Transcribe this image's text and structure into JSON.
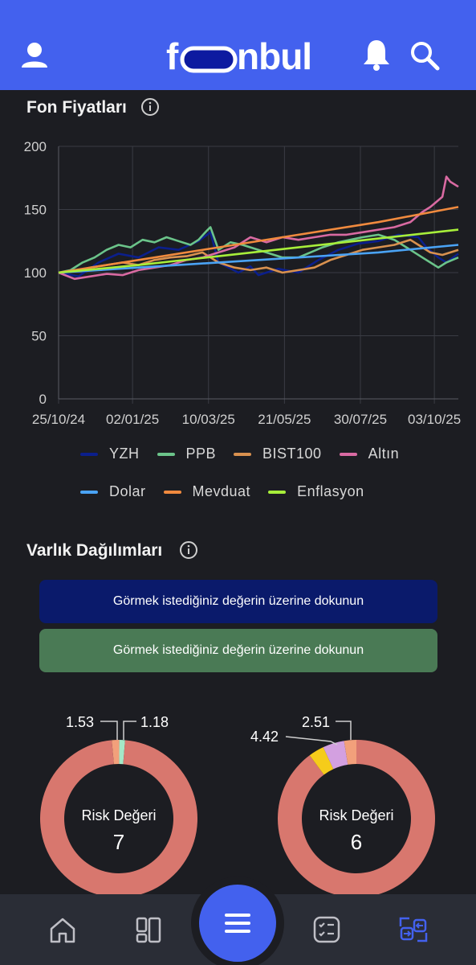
{
  "app": {
    "logo_text": "fonbul.",
    "colors": {
      "brand": "#4361ee",
      "background": "#1c1d22",
      "nav": "#2a2d36"
    },
    "icons": {
      "profile": "user-icon",
      "notifications": "bell-icon",
      "search": "search-icon"
    }
  },
  "prices_section": {
    "title": "Fon Fiyatları",
    "info_icon": "info-icon"
  },
  "chart_data": {
    "type": "line",
    "title": "",
    "xlabel": "",
    "ylabel": "",
    "ylim": [
      0,
      200
    ],
    "yticks": [
      0,
      50,
      100,
      150,
      200
    ],
    "xtick_labels": [
      "25/10/24",
      "02/01/25",
      "10/03/25",
      "21/05/25",
      "30/07/25",
      "03/10/25"
    ],
    "x_index_range": [
      0,
      100
    ],
    "xtick_positions": [
      0,
      18.5,
      37.5,
      56.5,
      75.5,
      94
    ],
    "grid": true,
    "legend_placement": "bottom",
    "series": [
      {
        "name": "YZH",
        "color": "#0b1f8c",
        "x": [
          0,
          5,
          10,
          15,
          20,
          25,
          30,
          35,
          38,
          40,
          45,
          48,
          50,
          55,
          60,
          65,
          70,
          75,
          80,
          85,
          90,
          92,
          95,
          97,
          100
        ],
        "y": [
          100,
          97,
          108,
          115,
          112,
          120,
          118,
          125,
          132,
          108,
          100,
          105,
          98,
          103,
          100,
          110,
          118,
          123,
          125,
          130,
          128,
          120,
          112,
          108,
          115
        ]
      },
      {
        "name": "PPB",
        "color": "#6bc48a",
        "x": [
          0,
          3,
          6,
          9,
          12,
          15,
          18,
          21,
          24,
          27,
          30,
          33,
          35,
          37,
          38,
          40,
          43,
          46,
          50,
          53,
          56,
          60,
          63,
          66,
          70,
          73,
          76,
          80,
          84,
          88,
          91,
          93,
          95,
          97,
          100
        ],
        "y": [
          100,
          102,
          108,
          112,
          118,
          122,
          120,
          126,
          124,
          128,
          125,
          122,
          126,
          133,
          136,
          118,
          124,
          122,
          118,
          115,
          112,
          112,
          116,
          120,
          124,
          126,
          128,
          130,
          126,
          118,
          112,
          108,
          104,
          108,
          112
        ]
      },
      {
        "name": "BIST100",
        "color": "#d9914f",
        "x": [
          0,
          4,
          8,
          12,
          16,
          20,
          24,
          28,
          32,
          36,
          38,
          40,
          44,
          48,
          52,
          56,
          60,
          64,
          68,
          72,
          76,
          80,
          84,
          88,
          90,
          93,
          96,
          100
        ],
        "y": [
          100,
          101,
          104,
          106,
          108,
          106,
          110,
          112,
          113,
          116,
          112,
          108,
          104,
          102,
          104,
          100,
          102,
          104,
          110,
          114,
          118,
          120,
          122,
          126,
          122,
          116,
          114,
          118
        ]
      },
      {
        "name": "Altın",
        "color": "#d96aa2",
        "x": [
          0,
          4,
          8,
          12,
          16,
          20,
          24,
          28,
          32,
          36,
          40,
          44,
          48,
          52,
          56,
          60,
          64,
          68,
          72,
          76,
          80,
          84,
          88,
          91,
          93,
          96,
          97,
          98,
          100
        ],
        "y": [
          100,
          95,
          97,
          99,
          98,
          102,
          104,
          106,
          110,
          112,
          116,
          120,
          128,
          124,
          128,
          126,
          128,
          130,
          130,
          132,
          134,
          136,
          140,
          148,
          152,
          160,
          176,
          172,
          168
        ]
      },
      {
        "name": "Dolar",
        "color": "#4aa3f5",
        "x": [
          0,
          20,
          40,
          60,
          80,
          100
        ],
        "y": [
          100,
          104,
          108,
          112,
          116,
          122
        ]
      },
      {
        "name": "Mevduat",
        "color": "#f08a3e",
        "x": [
          0,
          20,
          40,
          60,
          80,
          100
        ],
        "y": [
          100,
          110,
          120,
          130,
          140,
          152
        ]
      },
      {
        "name": "Enflasyon",
        "color": "#a7ee3a",
        "x": [
          0,
          20,
          40,
          60,
          80,
          100
        ],
        "y": [
          100,
          106,
          113,
          120,
          127,
          134
        ]
      }
    ]
  },
  "allocation_section": {
    "title": "Varlık Dağılımları",
    "info_icon": "info-icon",
    "banner_blue": "Görmek istediğiniz değerin üzerine dokunun",
    "banner_green": "Görmek istediğiniz değerin üzerine dokunun"
  },
  "donuts": [
    {
      "title": "Risk Değeri",
      "value": "7",
      "slices": [
        {
          "label": "1.53",
          "value": 1.53,
          "color": "#f2a07b"
        },
        {
          "label": "1.18",
          "value": 1.18,
          "color": "#a5e8c7"
        },
        {
          "label": "",
          "value": 97.29,
          "color": "#d8776e"
        }
      ]
    },
    {
      "title": "Risk Değeri",
      "value": "6",
      "slices": [
        {
          "label": "2.51",
          "value": 2.51,
          "color": "#f2a07b"
        },
        {
          "label": "4.42",
          "value": 4.42,
          "color": "#d3a0e0"
        },
        {
          "label": "",
          "value": 3.2,
          "color": "#f5cc1a"
        },
        {
          "label": "",
          "value": 89.87,
          "color": "#d8776e"
        }
      ]
    }
  ],
  "bottom_nav": {
    "items": [
      "home-icon",
      "dashboard-icon",
      "menu-icon",
      "checklist-icon",
      "compare-icon"
    ]
  }
}
